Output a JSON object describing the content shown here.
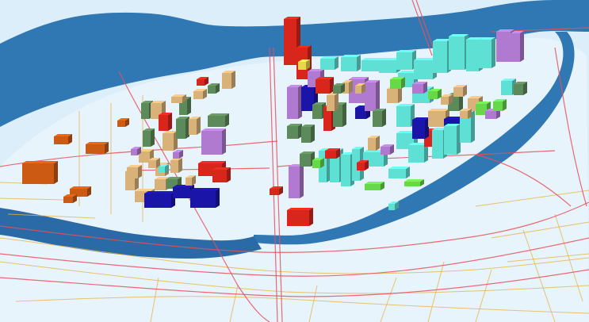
{
  "map": {
    "view": "3d-perspective-city-blocks",
    "colors": {
      "background_land": "#dceefa",
      "island_land": "#e8f4fc",
      "river": "#2f78b4",
      "river_dark": "#2a6aa6",
      "major_road": "#e8505a",
      "minor_road": "#e6b44a",
      "building_cyan": "#5fe0d4",
      "building_tan": "#d9b27a",
      "building_green": "#5d8a5a",
      "building_purple": "#b07ad0",
      "building_red": "#d8261c",
      "building_blue": "#1a14a8",
      "building_orange": "#cc5a12",
      "building_lime": "#66d84a",
      "building_yellow": "#e6d84a"
    },
    "legend": [],
    "labels": []
  }
}
